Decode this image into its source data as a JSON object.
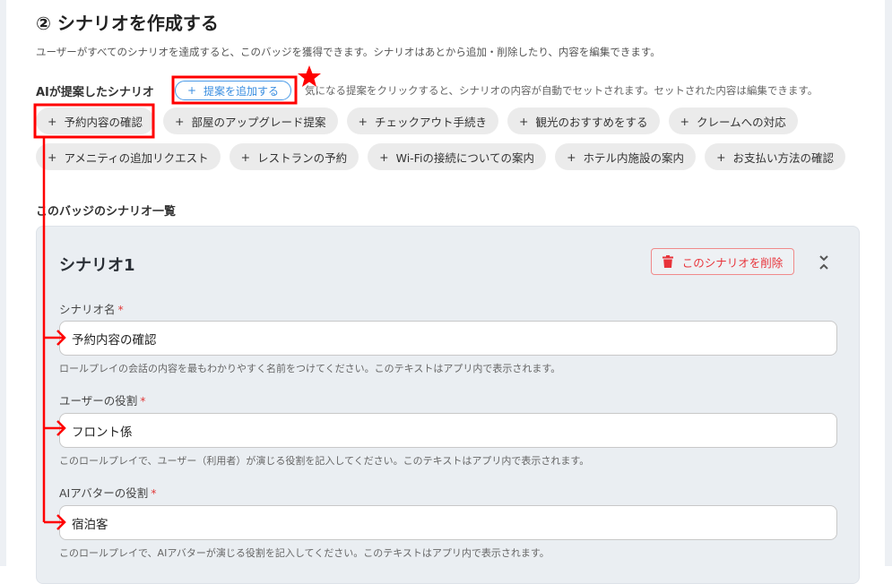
{
  "header": {
    "title": "② シナリオを作成する",
    "description": "ユーザーがすべてのシナリオを達成すると、このバッジを獲得できます。シナリオはあとから追加・削除したり、内容を編集できます。"
  },
  "suggestions": {
    "label": "AIが提案したシナリオ",
    "add_button": "提案を追加する",
    "hint": "気になる提案をクリックすると、シナリオの内容が自動でセットされます。セットされた内容は編集できます。",
    "row1": [
      "予約内容の確認",
      "部屋のアップグレード提案",
      "チェックアウト手続き",
      "観光のおすすめをする",
      "クレームへの対応"
    ],
    "row2": [
      "アメニティの追加リクエスト",
      "レストランの予約",
      "Wi-Fiの接続についての案内",
      "ホテル内施設の案内",
      "お支払い方法の確認"
    ]
  },
  "list_label": "このバッジのシナリオ一覧",
  "scenario": {
    "title": "シナリオ1",
    "delete_button": "このシナリオを削除",
    "fields": [
      {
        "label": "シナリオ名",
        "value": "予約内容の確認",
        "help": "ロールプレイの会話の内容を最もわかりやすく名前をつけてください。このテキストはアプリ内で表示されます。"
      },
      {
        "label": "ユーザーの役割",
        "value": "フロント係",
        "help": "このロールプレイで、ユーザー（利用者）が演じる役割を記入してください。このテキストはアプリ内で表示されます。"
      },
      {
        "label": "AIアバターの役割",
        "value": "宿泊客",
        "help": "このロールプレイで、AIアバターが演じる役割を記入してください。このテキストはアプリ内で表示されます。"
      }
    ],
    "required_mark": "*"
  },
  "plus": "+",
  "colors": {
    "accent": "#3a8ee0",
    "danger": "#e8333a",
    "annotation": "#ff0000"
  }
}
